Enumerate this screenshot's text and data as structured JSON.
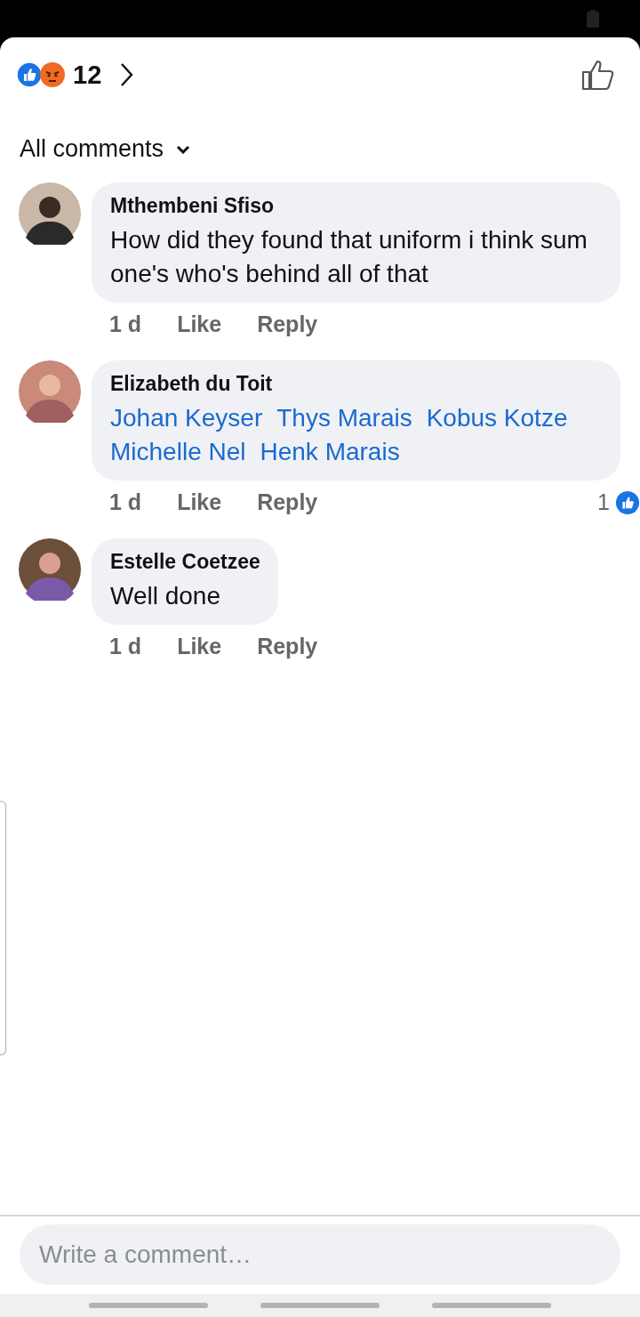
{
  "header": {
    "reaction_count": "12"
  },
  "filter": {
    "label": "All comments"
  },
  "comments": [
    {
      "author": "Mthembeni Sfiso",
      "kind": "text",
      "body": "How did they found that uniform i think sum one's who's behind all of that",
      "time": "1 d",
      "like": "Like",
      "reply": "Reply"
    },
    {
      "author": "Elizabeth du Toit",
      "kind": "mentions",
      "mentions": [
        "Johan Keyser",
        "Thys Marais",
        "Kobus Kotze",
        "Michelle Nel",
        "Henk Marais"
      ],
      "time": "1 d",
      "like": "Like",
      "reply": "Reply",
      "reaction_count": "1"
    },
    {
      "author": "Estelle Coetzee",
      "kind": "text",
      "body": "Well done",
      "time": "1 d",
      "like": "Like",
      "reply": "Reply"
    }
  ],
  "composer": {
    "placeholder": "Write a comment…"
  }
}
